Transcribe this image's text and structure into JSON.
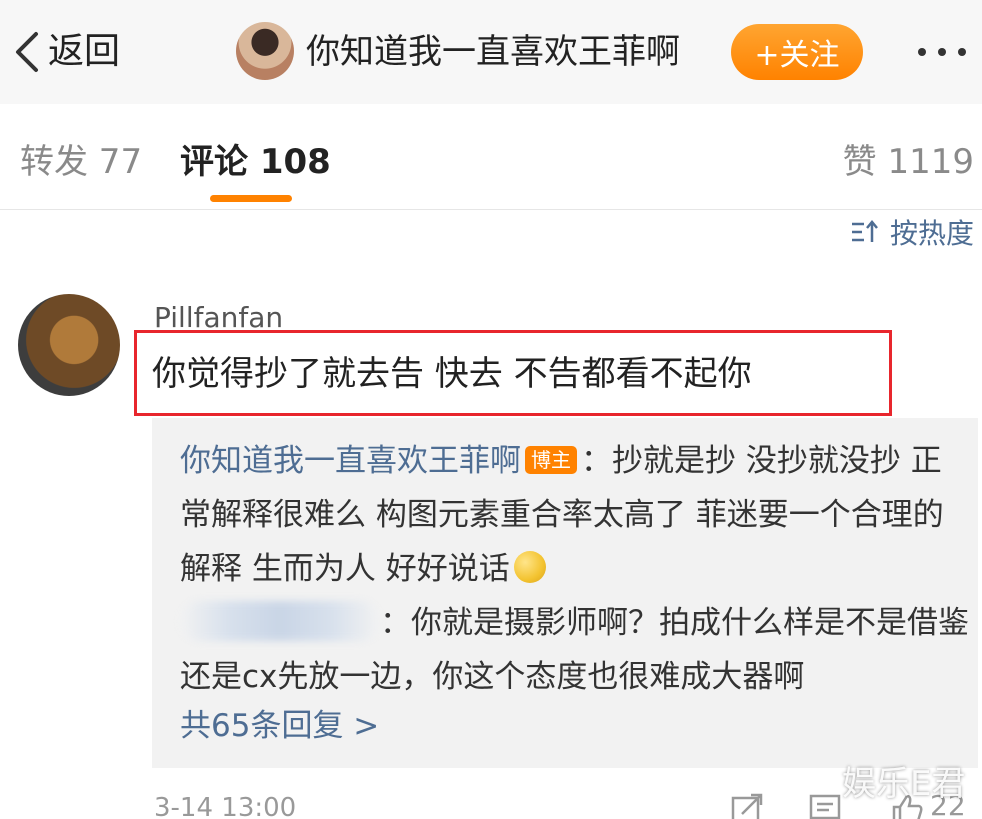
{
  "header": {
    "back_label": "返回",
    "title": "你知道我一直喜欢王菲啊",
    "follow_label": "+关注"
  },
  "tabs": {
    "repost": "转发 77",
    "comment": "评论 108",
    "like": "赞 1119"
  },
  "sort_label": "按热度",
  "comment": {
    "username": "Pillfanfan",
    "text": "你觉得抄了就去告 快去 不告都看不起你",
    "timestamp": "3-14 13:00",
    "like_count": "22"
  },
  "replies": [
    {
      "name": "你知道我一直喜欢王菲啊",
      "badge": "博主",
      "text": "：抄就是抄 没抄就没抄 正常解释很难么 构图元素重合率太高了 菲迷要一个合理的解释 生而为人 好好说话"
    },
    {
      "text": "：你就是摄影师啊？拍成什么样是不是借鉴还是cx先放一边，你这个态度也很难成大器啊"
    }
  ],
  "more_replies_label": "共65条回复 >",
  "watermark": "娱乐E君",
  "colors": {
    "accent": "#ff8200",
    "link": "#4e6d93",
    "highlight_border": "#e8262d"
  }
}
